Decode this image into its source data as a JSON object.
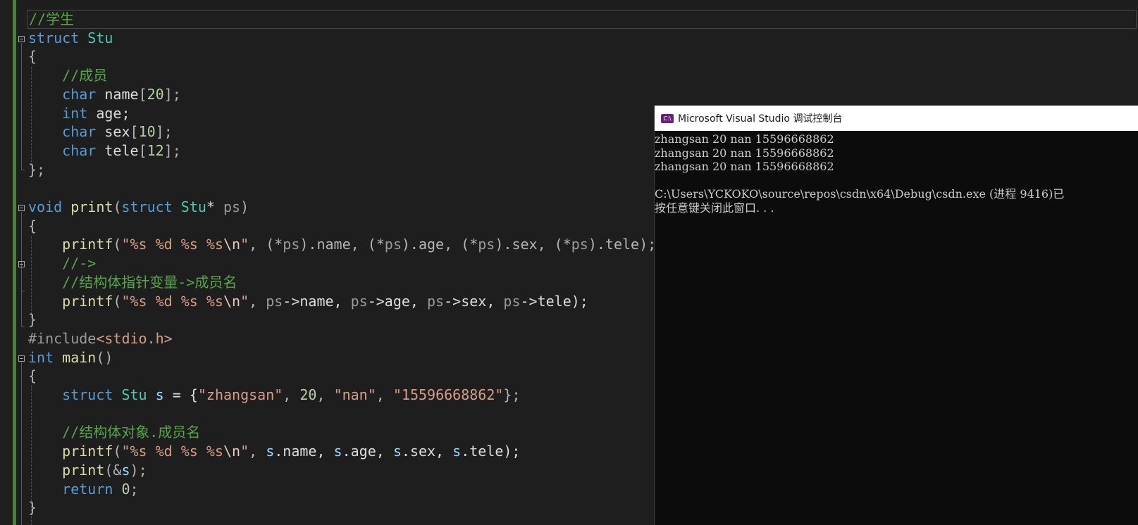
{
  "editor": {
    "lines": [
      [
        {
          "t": "//学生",
          "c": "cmt"
        }
      ],
      [
        {
          "t": "struct ",
          "c": "kw"
        },
        {
          "t": "Stu",
          "c": "type"
        }
      ],
      [
        {
          "t": "{",
          "c": "punc"
        }
      ],
      [
        {
          "t": "    //成员",
          "c": "cmt"
        }
      ],
      [
        {
          "t": "    ",
          "c": "txt"
        },
        {
          "t": "char",
          "c": "kw"
        },
        {
          "t": " name",
          "c": "txt"
        },
        {
          "t": "[",
          "c": "punc"
        },
        {
          "t": "20",
          "c": "num"
        },
        {
          "t": "];",
          "c": "punc"
        }
      ],
      [
        {
          "t": "    ",
          "c": "txt"
        },
        {
          "t": "int",
          "c": "kw"
        },
        {
          "t": " age;",
          "c": "txt"
        }
      ],
      [
        {
          "t": "    ",
          "c": "txt"
        },
        {
          "t": "char",
          "c": "kw"
        },
        {
          "t": " sex",
          "c": "txt"
        },
        {
          "t": "[",
          "c": "punc"
        },
        {
          "t": "10",
          "c": "num"
        },
        {
          "t": "];",
          "c": "punc"
        }
      ],
      [
        {
          "t": "    ",
          "c": "txt"
        },
        {
          "t": "char",
          "c": "kw"
        },
        {
          "t": " tele",
          "c": "txt"
        },
        {
          "t": "[",
          "c": "punc"
        },
        {
          "t": "12",
          "c": "num"
        },
        {
          "t": "];",
          "c": "punc"
        }
      ],
      [
        {
          "t": "};",
          "c": "punc"
        }
      ],
      [],
      [
        {
          "t": "void",
          "c": "kw"
        },
        {
          "t": " ",
          "c": "txt"
        },
        {
          "t": "print",
          "c": "fn"
        },
        {
          "t": "(",
          "c": "punc"
        },
        {
          "t": "struct",
          "c": "kw"
        },
        {
          "t": " ",
          "c": "txt"
        },
        {
          "t": "Stu",
          "c": "type"
        },
        {
          "t": "* ",
          "c": "txt"
        },
        {
          "t": "ps",
          "c": "param"
        },
        {
          "t": ")",
          "c": "punc"
        }
      ],
      [
        {
          "t": "{",
          "c": "punc"
        }
      ],
      [
        {
          "t": "    ",
          "c": "txt"
        },
        {
          "t": "printf",
          "c": "fn"
        },
        {
          "t": "(",
          "c": "punc"
        },
        {
          "t": "\"%s %d %s %s",
          "c": "str"
        },
        {
          "t": "\\n",
          "c": "esc"
        },
        {
          "t": "\"",
          "c": "str"
        },
        {
          "t": ", (*",
          "c": "punc"
        },
        {
          "t": "ps",
          "c": "param"
        },
        {
          "t": ").name, (*",
          "c": "punc"
        },
        {
          "t": "ps",
          "c": "param"
        },
        {
          "t": ").age, (*",
          "c": "punc"
        },
        {
          "t": "ps",
          "c": "param"
        },
        {
          "t": ").sex, (*",
          "c": "punc"
        },
        {
          "t": "ps",
          "c": "param"
        },
        {
          "t": ").tele);",
          "c": "punc"
        }
      ],
      [
        {
          "t": "    //->",
          "c": "cmt"
        }
      ],
      [
        {
          "t": "    //结构体指针变量->成员名",
          "c": "cmt"
        }
      ],
      [
        {
          "t": "    ",
          "c": "txt"
        },
        {
          "t": "printf",
          "c": "fn"
        },
        {
          "t": "(",
          "c": "punc"
        },
        {
          "t": "\"%s %d %s %s",
          "c": "str"
        },
        {
          "t": "\\n",
          "c": "esc"
        },
        {
          "t": "\"",
          "c": "str"
        },
        {
          "t": ", ",
          "c": "punc"
        },
        {
          "t": "ps",
          "c": "param"
        },
        {
          "t": "->name, ",
          "c": "txt"
        },
        {
          "t": "ps",
          "c": "param"
        },
        {
          "t": "->age, ",
          "c": "txt"
        },
        {
          "t": "ps",
          "c": "param"
        },
        {
          "t": "->sex, ",
          "c": "txt"
        },
        {
          "t": "ps",
          "c": "param"
        },
        {
          "t": "->tele);",
          "c": "txt"
        }
      ],
      [
        {
          "t": "}",
          "c": "punc"
        }
      ],
      [
        {
          "t": "#include",
          "c": "pre"
        },
        {
          "t": "<stdio.h>",
          "c": "str"
        }
      ],
      [
        {
          "t": "int",
          "c": "kw"
        },
        {
          "t": " ",
          "c": "txt"
        },
        {
          "t": "main",
          "c": "fn"
        },
        {
          "t": "()",
          "c": "punc"
        }
      ],
      [
        {
          "t": "{",
          "c": "punc"
        }
      ],
      [
        {
          "t": "    ",
          "c": "txt"
        },
        {
          "t": "struct",
          "c": "kw"
        },
        {
          "t": " ",
          "c": "txt"
        },
        {
          "t": "Stu",
          "c": "type"
        },
        {
          "t": " ",
          "c": "txt"
        },
        {
          "t": "s",
          "c": "var"
        },
        {
          "t": " = {",
          "c": "txt"
        },
        {
          "t": "\"zhangsan\"",
          "c": "str"
        },
        {
          "t": ", ",
          "c": "punc"
        },
        {
          "t": "20",
          "c": "num"
        },
        {
          "t": ", ",
          "c": "punc"
        },
        {
          "t": "\"nan\"",
          "c": "str"
        },
        {
          "t": ", ",
          "c": "punc"
        },
        {
          "t": "\"15596668862\"",
          "c": "str"
        },
        {
          "t": "};",
          "c": "punc"
        }
      ],
      [],
      [
        {
          "t": "    //结构体对象.成员名",
          "c": "cmt"
        }
      ],
      [
        {
          "t": "    ",
          "c": "txt"
        },
        {
          "t": "printf",
          "c": "fn"
        },
        {
          "t": "(",
          "c": "punc"
        },
        {
          "t": "\"%s %d %s %s",
          "c": "str"
        },
        {
          "t": "\\n",
          "c": "esc"
        },
        {
          "t": "\"",
          "c": "str"
        },
        {
          "t": ", ",
          "c": "punc"
        },
        {
          "t": "s",
          "c": "var"
        },
        {
          "t": ".name, ",
          "c": "txt"
        },
        {
          "t": "s",
          "c": "var"
        },
        {
          "t": ".age, ",
          "c": "txt"
        },
        {
          "t": "s",
          "c": "var"
        },
        {
          "t": ".sex, ",
          "c": "txt"
        },
        {
          "t": "s",
          "c": "var"
        },
        {
          "t": ".tele);",
          "c": "txt"
        }
      ],
      [
        {
          "t": "    ",
          "c": "txt"
        },
        {
          "t": "print",
          "c": "fn"
        },
        {
          "t": "(&",
          "c": "punc"
        },
        {
          "t": "s",
          "c": "var"
        },
        {
          "t": ");",
          "c": "punc"
        }
      ],
      [
        {
          "t": "    ",
          "c": "txt"
        },
        {
          "t": "return",
          "c": "kw"
        },
        {
          "t": " ",
          "c": "txt"
        },
        {
          "t": "0",
          "c": "num"
        },
        {
          "t": ";",
          "c": "punc"
        }
      ],
      [
        {
          "t": "}",
          "c": "punc"
        }
      ]
    ]
  },
  "console": {
    "title": "Microsoft Visual Studio 调试控制台",
    "icon": "visual-studio-console-icon",
    "output_lines": [
      "zhangsan 20 nan 15596668862",
      "zhangsan 20 nan 15596668862",
      "zhangsan 20 nan 15596668862",
      "",
      "C:\\Users\\YCKOKO\\source\\repos\\csdn\\x64\\Debug\\csdn.exe (进程 9416)已",
      "按任意键关闭此窗口. . ."
    ]
  },
  "colors": {
    "editor_bg": "#1e1e1e",
    "keyword": "#569cd6",
    "type": "#4ec9b0",
    "function": "#dcdcaa",
    "string": "#d69d85",
    "comment": "#57a64a",
    "change_bar": "#4b7f3a",
    "console_bg": "#0c0c0c"
  }
}
